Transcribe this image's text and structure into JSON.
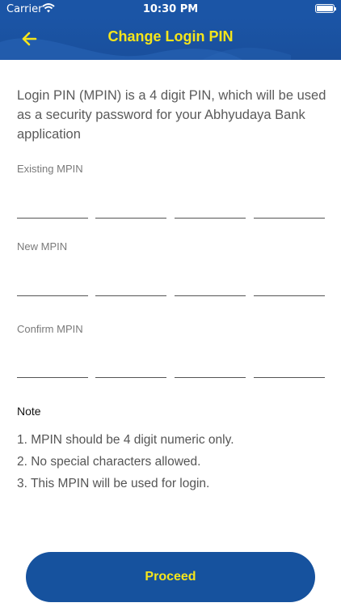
{
  "status_bar": {
    "carrier": "Carrier",
    "time": "10:30 PM"
  },
  "header": {
    "title": "Change Login PIN",
    "back_icon": "arrow-left-icon"
  },
  "intro_text": "Login PIN (MPIN) is a 4 digit PIN, which will be used as a security password for your Abhyudaya Bank application",
  "fields": [
    {
      "label": "Existing MPIN",
      "digits": [
        "",
        "",
        "",
        ""
      ]
    },
    {
      "label": "New MPIN",
      "digits": [
        "",
        "",
        "",
        ""
      ]
    },
    {
      "label": "Confirm MPIN",
      "digits": [
        "",
        "",
        "",
        ""
      ]
    }
  ],
  "note": {
    "title": "Note",
    "items": [
      "1. MPIN should be 4 digit numeric only.",
      "2. No special characters allowed.",
      "3. This MPIN will be used for login."
    ]
  },
  "proceed_label": "Proceed",
  "colors": {
    "primary": "#1b55a6",
    "accent": "#f5e51b"
  }
}
